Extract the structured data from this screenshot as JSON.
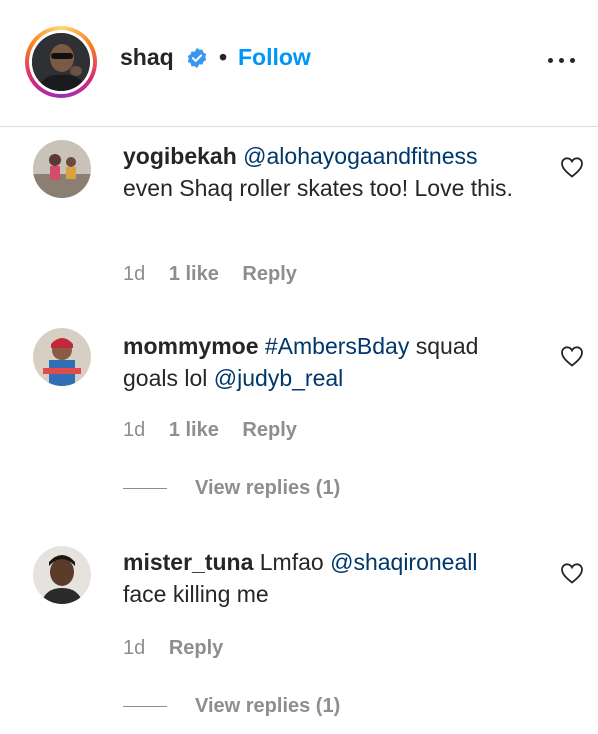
{
  "header": {
    "username": "shaq",
    "separator": "•",
    "follow_label": "Follow",
    "verified_icon": "verified-badge-icon",
    "more_icon": "more-options-icon"
  },
  "comments": [
    {
      "username": "yogibekah",
      "mention": "@alohayogaandfitness",
      "text": "even Shaq roller skates too! Love this.",
      "time": "1d",
      "likes": "1 like",
      "reply_label": "Reply"
    },
    {
      "username": "mommymoe",
      "mention": "#AmbersBday",
      "text_mid": "squad goals lol",
      "mention2": "@judyb_real",
      "time": "1d",
      "likes": "1 like",
      "reply_label": "Reply",
      "view_replies": "View replies (1)"
    },
    {
      "username": "mister_tuna",
      "text_pre": "Lmfao",
      "mention": "@shaqironeall",
      "text": "face killing me",
      "time": "1d",
      "reply_label": "Reply",
      "view_replies": "View replies (1)"
    }
  ],
  "colors": {
    "link": "#0095f6",
    "mention": "#00376b",
    "muted": "#8e8e8e",
    "text": "#262626"
  }
}
